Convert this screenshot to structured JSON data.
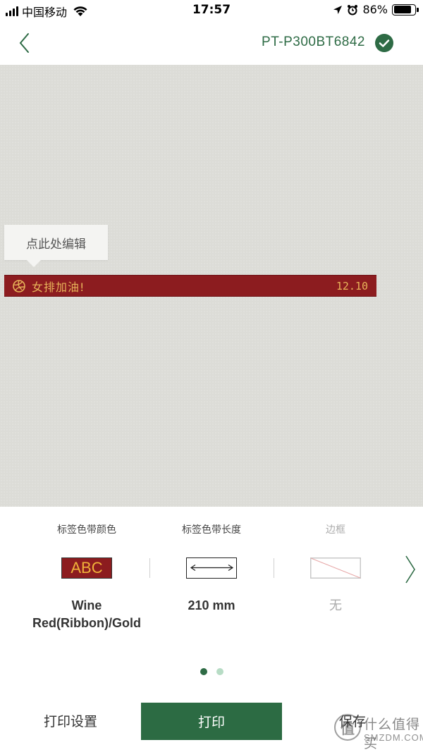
{
  "status_bar": {
    "carrier": "中国移动",
    "time": "17:57",
    "battery": "86%",
    "battery_level": 0.86
  },
  "nav": {
    "device_name": "PT-P300BT6842"
  },
  "canvas": {
    "tooltip": "点此处编辑",
    "label_text": "女排加油!",
    "label_date": "12.10",
    "label_colors": {
      "ribbon": "#8c1c1f",
      "text": "#e8b45a"
    }
  },
  "settings": {
    "items": [
      {
        "title": "标签色带颜色",
        "value": "Wine Red(Ribbon)/Gold",
        "preview": "ABC"
      },
      {
        "title": "标签色带长度",
        "value": "210 mm"
      },
      {
        "title": "边框",
        "value": "无"
      }
    ],
    "page_count": 2,
    "current_page": 1
  },
  "bottom": {
    "print_settings": "打印设置",
    "print": "打印",
    "save": "保存"
  },
  "watermark": {
    "logo": "值",
    "text": "什么值得买",
    "sub": "SMZDM.COM"
  },
  "colors": {
    "accent": "#2c6b43",
    "canvas_bg": "#dcdcd7"
  }
}
